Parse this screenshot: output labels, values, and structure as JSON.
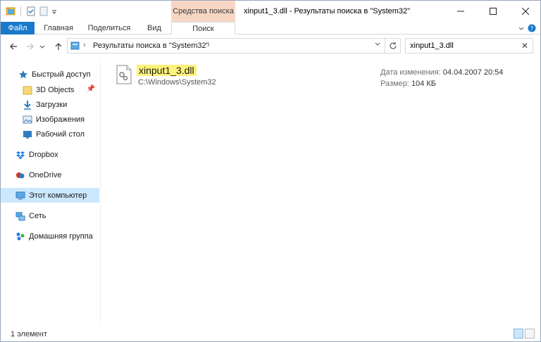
{
  "window": {
    "title": "xinput1_3.dll - Результаты поиска в \"System32\"",
    "context_tab_group": "Средства поиска"
  },
  "ribbon": {
    "tabs": [
      {
        "label": "Файл"
      },
      {
        "label": "Главная"
      },
      {
        "label": "Поделиться"
      },
      {
        "label": "Вид"
      },
      {
        "label": "Поиск"
      }
    ]
  },
  "address": {
    "breadcrumb": "Результаты поиска в \"System32\""
  },
  "search": {
    "value": "xinput1_3.dll"
  },
  "navpane": {
    "items": [
      {
        "label": "Быстрый доступ",
        "icon": "star-icon"
      },
      {
        "label": "3D Objects",
        "icon": "folder-icon"
      },
      {
        "label": "Загрузки",
        "icon": "download-icon"
      },
      {
        "label": "Изображения",
        "icon": "pictures-icon"
      },
      {
        "label": "Рабочий стол",
        "icon": "desktop-icon"
      },
      {
        "label": "Dropbox",
        "icon": "dropbox-icon"
      },
      {
        "label": "OneDrive",
        "icon": "onedrive-icon"
      },
      {
        "label": "Этот компьютер",
        "icon": "computer-icon"
      },
      {
        "label": "Сеть",
        "icon": "network-icon"
      },
      {
        "label": "Домашняя группа",
        "icon": "homegroup-icon"
      }
    ]
  },
  "result": {
    "name": "xinput1_3.dll",
    "path": "C:\\Windows\\System32",
    "date_label": "Дата изменения:",
    "date_value": "04.04.2007 20:54",
    "size_label": "Размер:",
    "size_value": "104 КБ"
  },
  "status": {
    "count": "1 элемент"
  },
  "colors": {
    "accent": "#1979ca",
    "context_tab": "#f7d7c4",
    "highlight": "#fff27a",
    "selection": "#cce8ff"
  }
}
